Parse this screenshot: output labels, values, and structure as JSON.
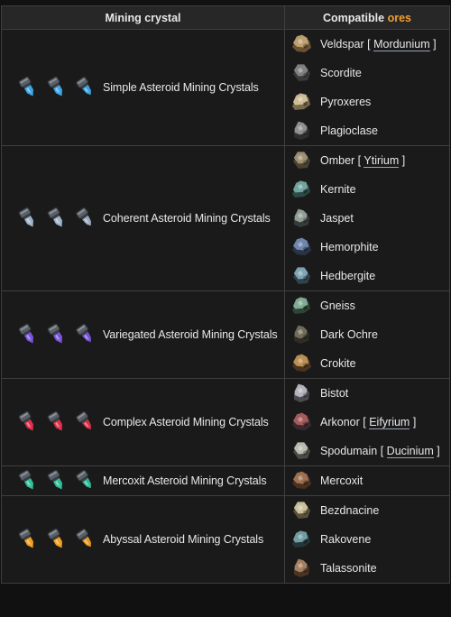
{
  "header": {
    "col1": "Mining crystal",
    "col2_prefix": "Compatible ",
    "col2_highlight": "ores",
    "highlight_color": "#f0a030"
  },
  "rows": [
    {
      "crystal": "Simple Asteroid Mining Crystals",
      "crystal_color": "#3ea6e8",
      "ores": [
        {
          "name": "Veldspar",
          "variant": "Mordunium",
          "icon": "veldspar-ore-icon"
        },
        {
          "name": "Scordite",
          "icon": "scordite-ore-icon"
        },
        {
          "name": "Pyroxeres",
          "icon": "pyroxeres-ore-icon"
        },
        {
          "name": "Plagioclase",
          "icon": "plagioclase-ore-icon"
        }
      ]
    },
    {
      "crystal": "Coherent Asteroid Mining Crystals",
      "crystal_color": "#9fb4c8",
      "ores": [
        {
          "name": "Omber",
          "variant": "Ytirium",
          "icon": "omber-ore-icon"
        },
        {
          "name": "Kernite",
          "icon": "kernite-ore-icon"
        },
        {
          "name": "Jaspet",
          "icon": "jaspet-ore-icon"
        },
        {
          "name": "Hemorphite",
          "icon": "hemorphite-ore-icon"
        },
        {
          "name": "Hedbergite",
          "icon": "hedbergite-ore-icon"
        }
      ]
    },
    {
      "crystal": "Variegated Asteroid Mining Crystals",
      "crystal_color": "#7b55e0",
      "ores": [
        {
          "name": "Gneiss",
          "icon": "gneiss-ore-icon"
        },
        {
          "name": "Dark Ochre",
          "icon": "dark-ochre-ore-icon"
        },
        {
          "name": "Crokite",
          "icon": "crokite-ore-icon"
        }
      ]
    },
    {
      "crystal": "Complex Asteroid Mining Crystals",
      "crystal_color": "#e0304a",
      "ores": [
        {
          "name": "Bistot",
          "icon": "bistot-ore-icon"
        },
        {
          "name": "Arkonor",
          "variant": "Eifyrium",
          "icon": "arkonor-ore-icon"
        },
        {
          "name": "Spodumain",
          "variant": "Ducinium",
          "icon": "spodumain-ore-icon"
        }
      ]
    },
    {
      "crystal": "Mercoxit Asteroid Mining Crystals",
      "crystal_color": "#2fc09a",
      "ores": [
        {
          "name": "Mercoxit",
          "icon": "mercoxit-ore-icon"
        }
      ]
    },
    {
      "crystal": "Abyssal Asteroid Mining Crystals",
      "crystal_color": "#f0a020",
      "ores": [
        {
          "name": "Bezdnacine",
          "icon": "bezdnacine-ore-icon"
        },
        {
          "name": "Rakovene",
          "icon": "rakovene-ore-icon"
        },
        {
          "name": "Talassonite",
          "icon": "talassonite-ore-icon"
        }
      ]
    }
  ]
}
